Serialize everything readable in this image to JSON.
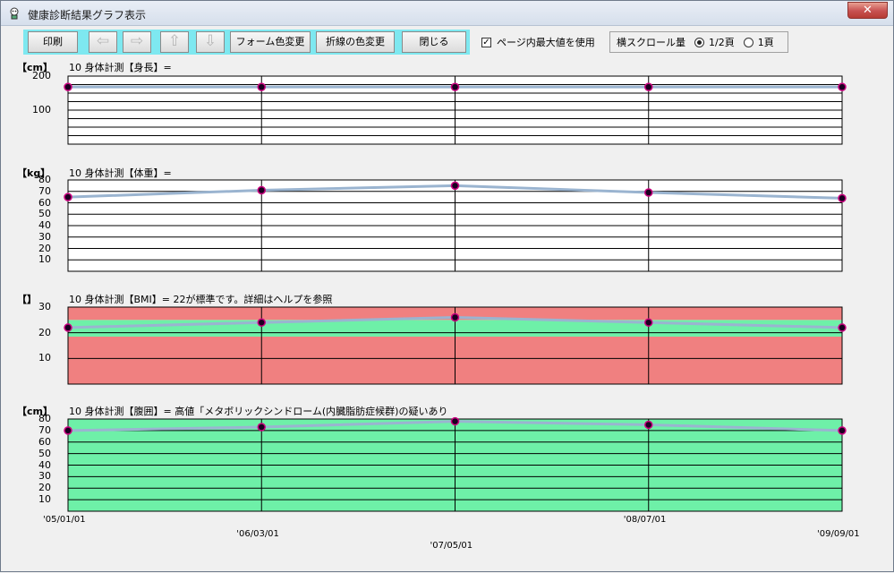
{
  "window": {
    "title": "健康診断結果グラフ表示",
    "close_label": "✕"
  },
  "toolbar": {
    "print_label": "印刷",
    "left_arrow": "⇦",
    "right_arrow": "⇨",
    "up_arrow": "⇧",
    "down_arrow": "⇩",
    "form_color_label": "フォーム色変更",
    "line_color_label": "折線の色変更",
    "close_label": "閉じる"
  },
  "options": {
    "page_max_label": "ページ内最大値を使用",
    "page_max_checked": true,
    "hscroll_label": "横スクロール量",
    "half_page_label": "1/2頁",
    "one_page_label": "1頁",
    "selected": "1/2頁"
  },
  "colors": {
    "line": "#9ab4d0",
    "marker": "#cc0080",
    "red_zone": "#f08080",
    "green_zone": "#6ef0a8",
    "toolbar_bg": "#7ee8f0"
  },
  "x_labels": [
    "'05/01/01",
    "'06/03/01",
    "'07/05/01",
    "'08/07/01",
    "'09/09/01"
  ],
  "chart_data": [
    {
      "type": "line",
      "unit": "【cm】",
      "title": "10 身体計測【身長】=",
      "categories": [
        "'05/01/01",
        "'06/03/01",
        "'07/05/01",
        "'08/07/01",
        "'09/09/01"
      ],
      "y_ticks": [
        "200",
        "100"
      ],
      "ylim": [
        0,
        200
      ],
      "values": [
        168,
        168,
        168,
        168,
        168
      ],
      "grid": true
    },
    {
      "type": "line",
      "unit": "【kg】",
      "title": "10 身体計測【体重】=",
      "categories": [
        "'05/01/01",
        "'06/03/01",
        "'07/05/01",
        "'08/07/01",
        "'09/09/01"
      ],
      "y_ticks": [
        "80",
        "70",
        "60",
        "50",
        "40",
        "30",
        "20",
        "10"
      ],
      "ylim": [
        0,
        80
      ],
      "values": [
        65,
        71,
        75,
        69,
        64
      ],
      "grid": true
    },
    {
      "type": "line",
      "unit": "【】",
      "title": "10 身体計測【BMI】= 22が標準です。詳細はヘルプを参照",
      "categories": [
        "'05/01/01",
        "'06/03/01",
        "'07/05/01",
        "'08/07/01",
        "'09/09/01"
      ],
      "y_ticks": [
        "30",
        "20",
        "10"
      ],
      "ylim": [
        0,
        30
      ],
      "values": [
        22,
        24,
        26,
        24,
        22
      ],
      "zones": [
        {
          "from": 0,
          "to": 18.5,
          "color": "red"
        },
        {
          "from": 18.5,
          "to": 25,
          "color": "green"
        },
        {
          "from": 25,
          "to": 30,
          "color": "red"
        }
      ],
      "grid": true
    },
    {
      "type": "line",
      "unit": "【cm】",
      "title": "10 身体計測【腹囲】= 高値「メタボリックシンドローム(内臓脂肪症候群)の疑いあり",
      "categories": [
        "'05/01/01",
        "'06/03/01",
        "'07/05/01",
        "'08/07/01",
        "'09/09/01"
      ],
      "y_ticks": [
        "80",
        "70",
        "60",
        "50",
        "40",
        "30",
        "20",
        "10"
      ],
      "ylim": [
        0,
        80
      ],
      "values": [
        70,
        73,
        78,
        75,
        70
      ],
      "zones": [
        {
          "from": 0,
          "to": 80,
          "color": "green"
        }
      ],
      "grid": true
    }
  ]
}
